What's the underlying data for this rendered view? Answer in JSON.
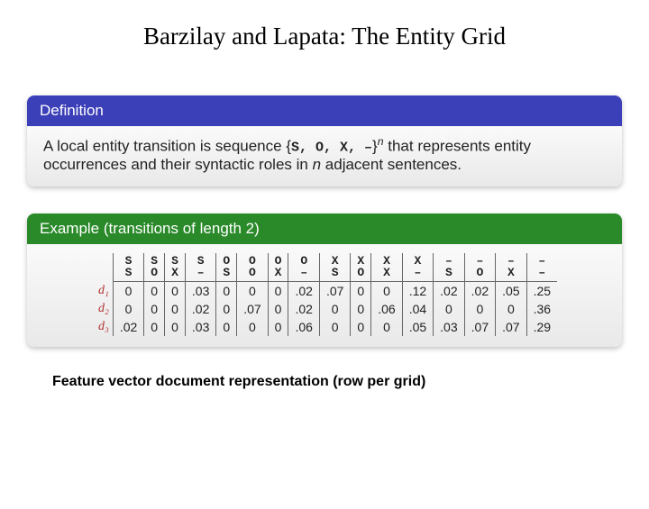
{
  "title": "Barzilay and Lapata: The Entity Grid",
  "definition": {
    "header": "Definition",
    "pre": "A local entity transition is sequence ",
    "seq_open": "{",
    "seq_sym": "S, O, X, –",
    "seq_close": "}",
    "exp": "n",
    "mid": " that represents entity occurrences and their syntactic roles in ",
    "nvar": "n",
    "post": " adjacent sentences."
  },
  "example": {
    "header": "Example (transitions of length 2)",
    "cols": [
      [
        "S",
        "S"
      ],
      [
        "S",
        "O"
      ],
      [
        "S",
        "X"
      ],
      [
        "S",
        "–"
      ],
      [
        "O",
        "S"
      ],
      [
        "O",
        "O"
      ],
      [
        "O",
        "X"
      ],
      [
        "O",
        "–"
      ],
      [
        "X",
        "S"
      ],
      [
        "X",
        "O"
      ],
      [
        "X",
        "X"
      ],
      [
        "X",
        "–"
      ],
      [
        "–",
        "S"
      ],
      [
        "–",
        "O"
      ],
      [
        "–",
        "X"
      ],
      [
        "–",
        "–"
      ]
    ],
    "rowlabels": [
      "d₁",
      "d₂",
      "d₃"
    ],
    "rows": [
      [
        "0",
        "0",
        "0",
        ".03",
        "0",
        "0",
        "0",
        ".02",
        ".07",
        "0",
        "0",
        ".12",
        ".02",
        ".02",
        ".05",
        ".25"
      ],
      [
        "0",
        "0",
        "0",
        ".02",
        "0",
        ".07",
        "0",
        ".02",
        "0",
        "0",
        ".06",
        ".04",
        "0",
        "0",
        "0",
        ".36"
      ],
      [
        ".02",
        "0",
        "0",
        ".03",
        "0",
        "0",
        "0",
        ".06",
        "0",
        "0",
        "0",
        ".05",
        ".03",
        ".07",
        ".07",
        ".29"
      ]
    ]
  },
  "footer": "Feature vector document representation (row per grid)"
}
